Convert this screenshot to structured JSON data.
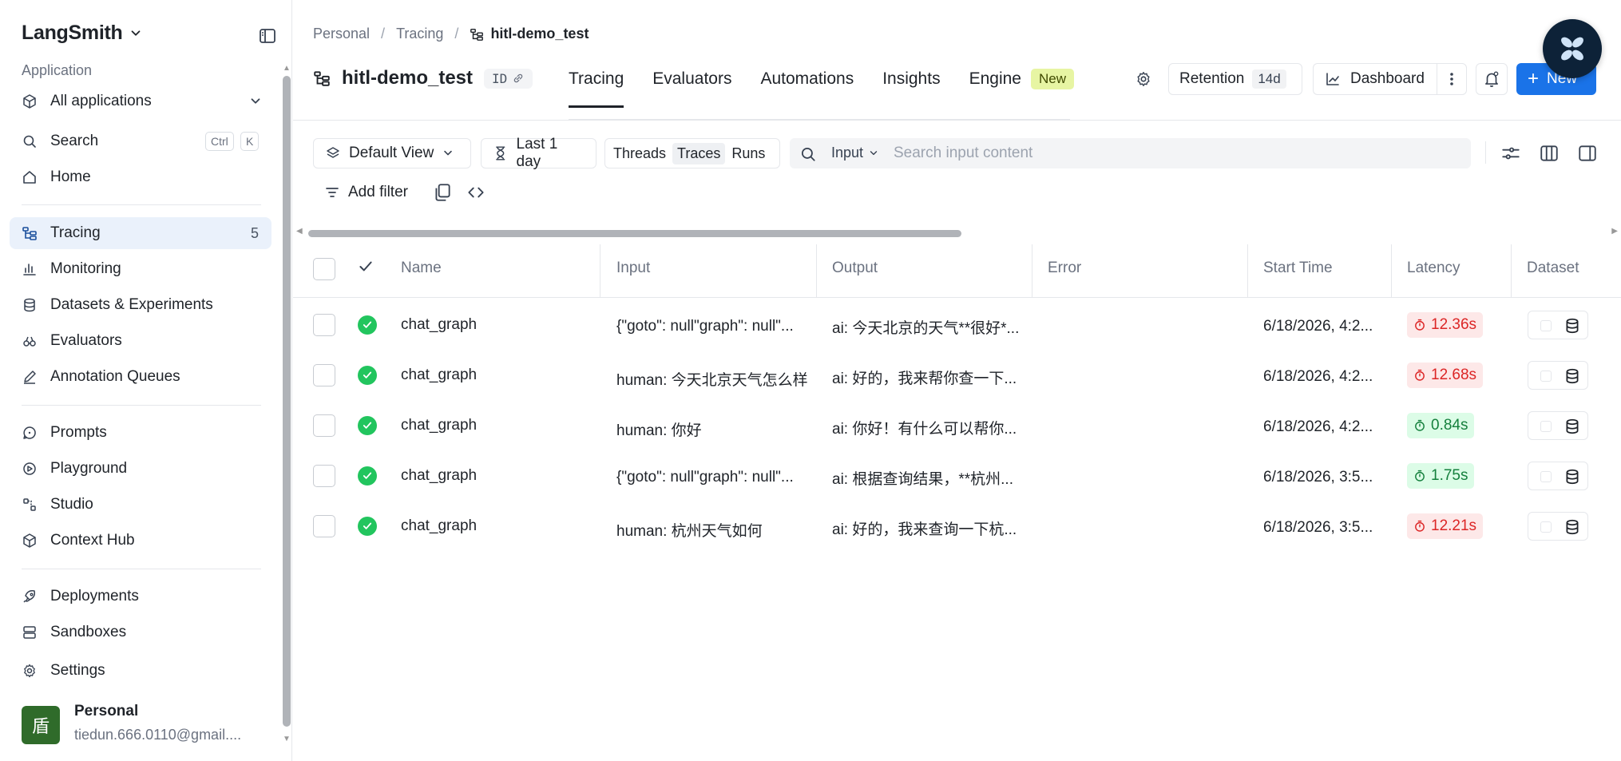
{
  "sidebar": {
    "brand": "LangSmith",
    "section_label": "Application",
    "app_select": "All applications",
    "search": {
      "label": "Search",
      "kbd1": "Ctrl",
      "kbd2": "K"
    },
    "home": "Home",
    "items_group1": [
      {
        "label": "Tracing",
        "count": "5",
        "icon": "tracing-icon",
        "active": true
      },
      {
        "label": "Monitoring",
        "icon": "monitoring-icon"
      },
      {
        "label": "Datasets & Experiments",
        "icon": "datasets-icon"
      },
      {
        "label": "Evaluators",
        "icon": "evaluators-icon"
      },
      {
        "label": "Annotation Queues",
        "icon": "annotation-icon"
      }
    ],
    "items_group2": [
      {
        "label": "Prompts",
        "icon": "prompts-icon"
      },
      {
        "label": "Playground",
        "icon": "playground-icon"
      },
      {
        "label": "Studio",
        "icon": "studio-icon"
      },
      {
        "label": "Context Hub",
        "icon": "context-hub-icon"
      }
    ],
    "items_group3": [
      {
        "label": "Deployments",
        "icon": "rocket-icon"
      },
      {
        "label": "Sandboxes",
        "icon": "sandboxes-icon"
      },
      {
        "label": "Settings",
        "icon": "gear-icon"
      }
    ],
    "profile": {
      "avatar_char": "盾",
      "name": "Personal",
      "email": "tiedun.666.0110@gmail...."
    }
  },
  "breadcrumb": [
    "Personal",
    "Tracing",
    "hitl-demo_test"
  ],
  "project": {
    "title": "hitl-demo_test",
    "id_label": "ID"
  },
  "tabs": [
    {
      "label": "Tracing",
      "active": true
    },
    {
      "label": "Evaluators"
    },
    {
      "label": "Automations"
    },
    {
      "label": "Insights"
    },
    {
      "label": "Engine",
      "badge": "New"
    }
  ],
  "actions": {
    "retention_label": "Retention",
    "retention_value": "14d",
    "dashboard_label": "Dashboard",
    "new_label": "New"
  },
  "toolbar": {
    "view": "Default View",
    "time_range": "Last 1 day",
    "segments": [
      "Threads",
      "Traces",
      "Runs"
    ],
    "active_segment": "Traces",
    "search_field": "Input",
    "search_placeholder": "Search input content",
    "add_filter": "Add filter"
  },
  "table": {
    "columns": [
      "Name",
      "Input",
      "Output",
      "Error",
      "Start Time",
      "Latency",
      "Dataset"
    ],
    "rows": [
      {
        "name": "chat_graph",
        "input": "{\"goto\": null\"graph\": null\"...",
        "output": "ai: 今天北京的天气**很好*...",
        "error": "",
        "start": "6/18/2026, 4:2...",
        "latency": "12.36s",
        "latency_status": "slow"
      },
      {
        "name": "chat_graph",
        "input": "human: 今天北京天气怎么样",
        "output": "ai: 好的，我来帮你查一下...",
        "error": "",
        "start": "6/18/2026, 4:2...",
        "latency": "12.68s",
        "latency_status": "slow"
      },
      {
        "name": "chat_graph",
        "input": "human: 你好",
        "output": "ai: 你好！有什么可以帮你...",
        "error": "",
        "start": "6/18/2026, 4:2...",
        "latency": "0.84s",
        "latency_status": "fast"
      },
      {
        "name": "chat_graph",
        "input": "{\"goto\": null\"graph\": null\"...",
        "output": "ai: 根据查询结果，**杭州...",
        "error": "",
        "start": "6/18/2026, 3:5...",
        "latency": "1.75s",
        "latency_status": "fast"
      },
      {
        "name": "chat_graph",
        "input": "human: 杭州天气如何",
        "output": "ai: 好的，我来查询一下杭...",
        "error": "",
        "start": "6/18/2026, 3:5...",
        "latency": "12.21s",
        "latency_status": "slow"
      }
    ]
  },
  "colors": {
    "accent": "#1a73e8",
    "active_nav_bg": "#eaf1fb",
    "success": "#22c55e",
    "slow_latency": "#dc2626",
    "fast_latency": "#15803d",
    "new_badge": "#e7f5a3"
  }
}
